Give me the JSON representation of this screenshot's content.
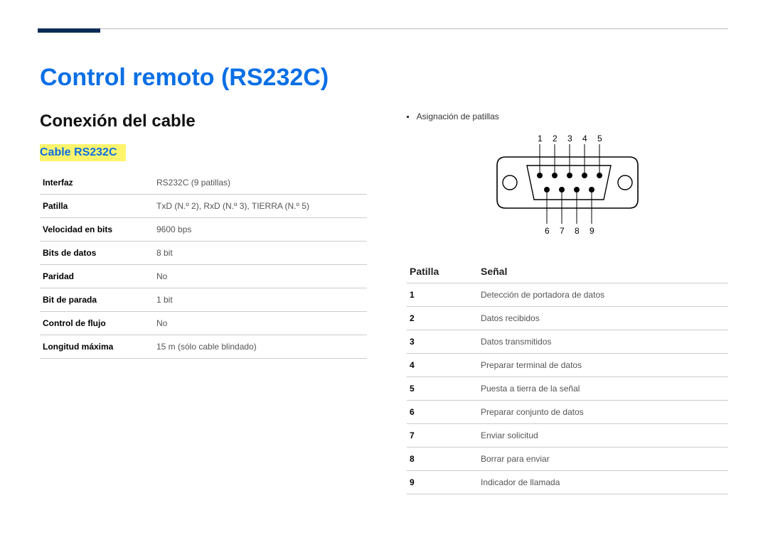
{
  "header": {
    "title": "Control remoto (RS232C)",
    "section": "Conexión del cable",
    "subsection": "Cable RS232C"
  },
  "spec_table": {
    "rows": [
      {
        "label": "Interfaz",
        "value": "RS232C (9 patillas)"
      },
      {
        "label": "Patilla",
        "value": "TxD (N.º 2), RxD (N.º 3), TIERRA (N.º 5)"
      },
      {
        "label": "Velocidad en bits",
        "value": "9600 bps"
      },
      {
        "label": "Bits de datos",
        "value": "8 bit"
      },
      {
        "label": "Paridad",
        "value": "No"
      },
      {
        "label": "Bit de parada",
        "value": "1 bit"
      },
      {
        "label": "Control de flujo",
        "value": "No"
      },
      {
        "label": "Longitud máxima",
        "value": "15 m (sólo cable blindado)"
      }
    ]
  },
  "right": {
    "bullet": "Asignación de patillas"
  },
  "connector": {
    "top_labels": [
      "1",
      "2",
      "3",
      "4",
      "5"
    ],
    "bottom_labels": [
      "6",
      "7",
      "8",
      "9"
    ]
  },
  "signal_table": {
    "columns": {
      "pin": "Patilla",
      "signal": "Señal"
    },
    "rows": [
      {
        "pin": "1",
        "signal": "Detección de portadora de datos"
      },
      {
        "pin": "2",
        "signal": "Datos recibidos"
      },
      {
        "pin": "3",
        "signal": "Datos transmitidos"
      },
      {
        "pin": "4",
        "signal": "Preparar terminal de datos"
      },
      {
        "pin": "5",
        "signal": "Puesta a tierra de la señal"
      },
      {
        "pin": "6",
        "signal": "Preparar conjunto de datos"
      },
      {
        "pin": "7",
        "signal": "Enviar solicitud"
      },
      {
        "pin": "8",
        "signal": "Borrar para enviar"
      },
      {
        "pin": "9",
        "signal": "Indicador de llamada"
      }
    ]
  }
}
